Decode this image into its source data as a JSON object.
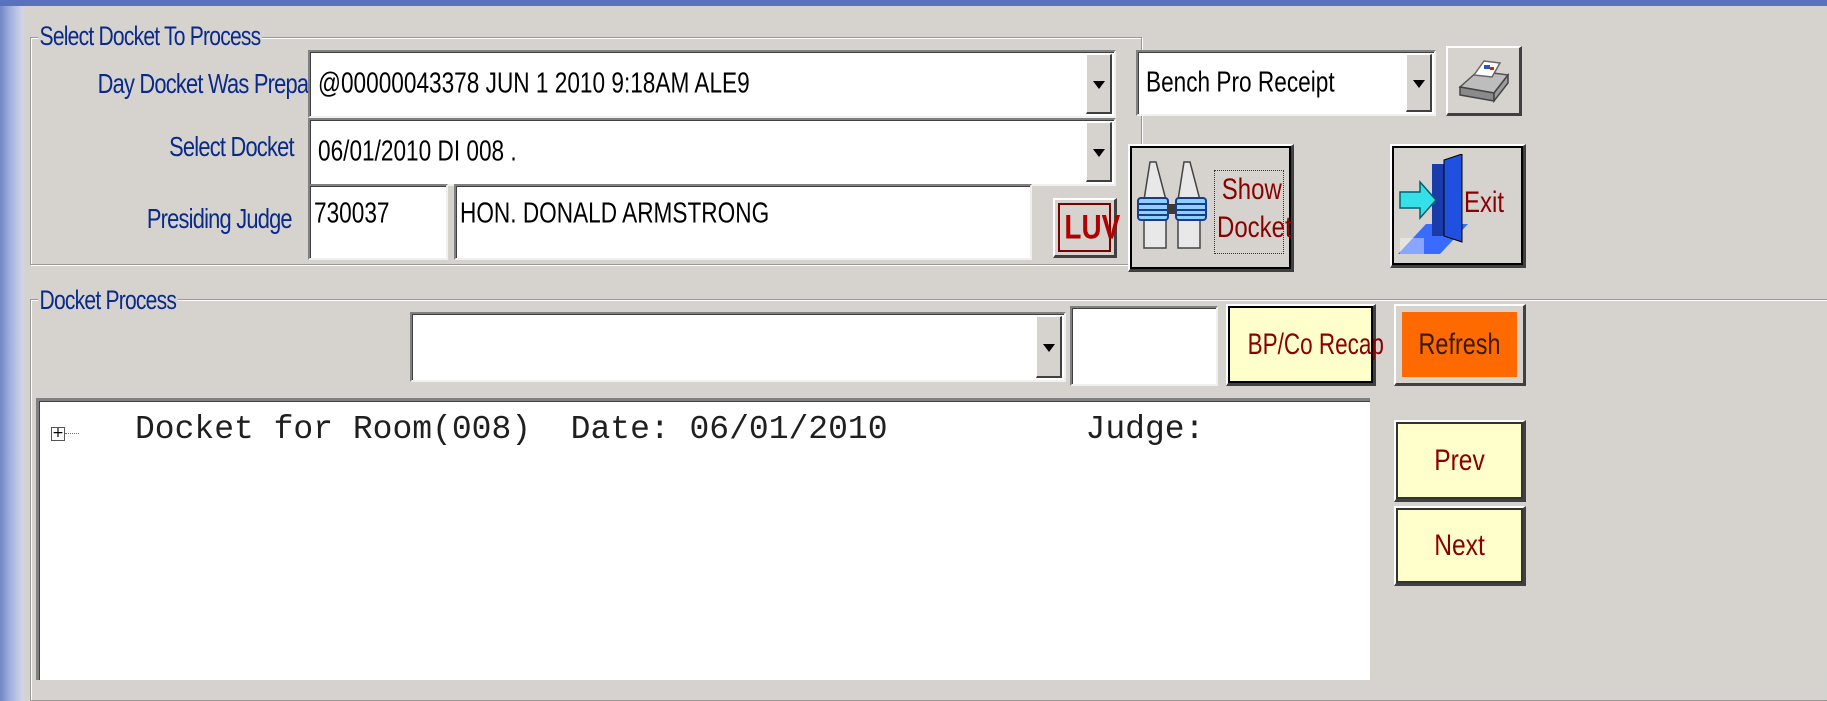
{
  "select_docket_group": {
    "legend": "Select Docket To Process",
    "day_prepared_label": "Day Docket Was Prepared",
    "day_prepared_value": "@00000043378    JUN  1 2010  9:18AM   ALE9",
    "select_docket_label": "Select Docket",
    "select_docket_value": "06/01/2010            DI   008            .",
    "presiding_judge_label": "Presiding Judge",
    "judge_code": "730037",
    "judge_name": "HON. DONALD ARMSTRONG",
    "luv_button": "LUV"
  },
  "report_select": {
    "value": "Bench Pro Receipt"
  },
  "show_docket_button": {
    "line1": "Show",
    "line2": "Docket"
  },
  "exit_button": {
    "label": "Exit"
  },
  "docket_process_group": {
    "legend": "Docket Process",
    "combo_value": "",
    "small_field_value": "",
    "recap_button": "BP/Co Recap",
    "refresh_button": "Refresh"
  },
  "tree": {
    "expander": "+",
    "root_text": "Docket for Room(008)  Date: 06/01/2010          Judge:"
  },
  "nav": {
    "prev": "Prev",
    "next": "Next"
  },
  "icons": [
    "printer-icon",
    "binoculars-icon",
    "exit-door-icon",
    "tree-expand-icon",
    "dropdown-arrow-icon"
  ],
  "colors": {
    "label_blue": "#0a2a8a",
    "refresh_bg": "#ff6a00",
    "cream_btn": "#ffffcc",
    "luv_red": "#b00000"
  }
}
